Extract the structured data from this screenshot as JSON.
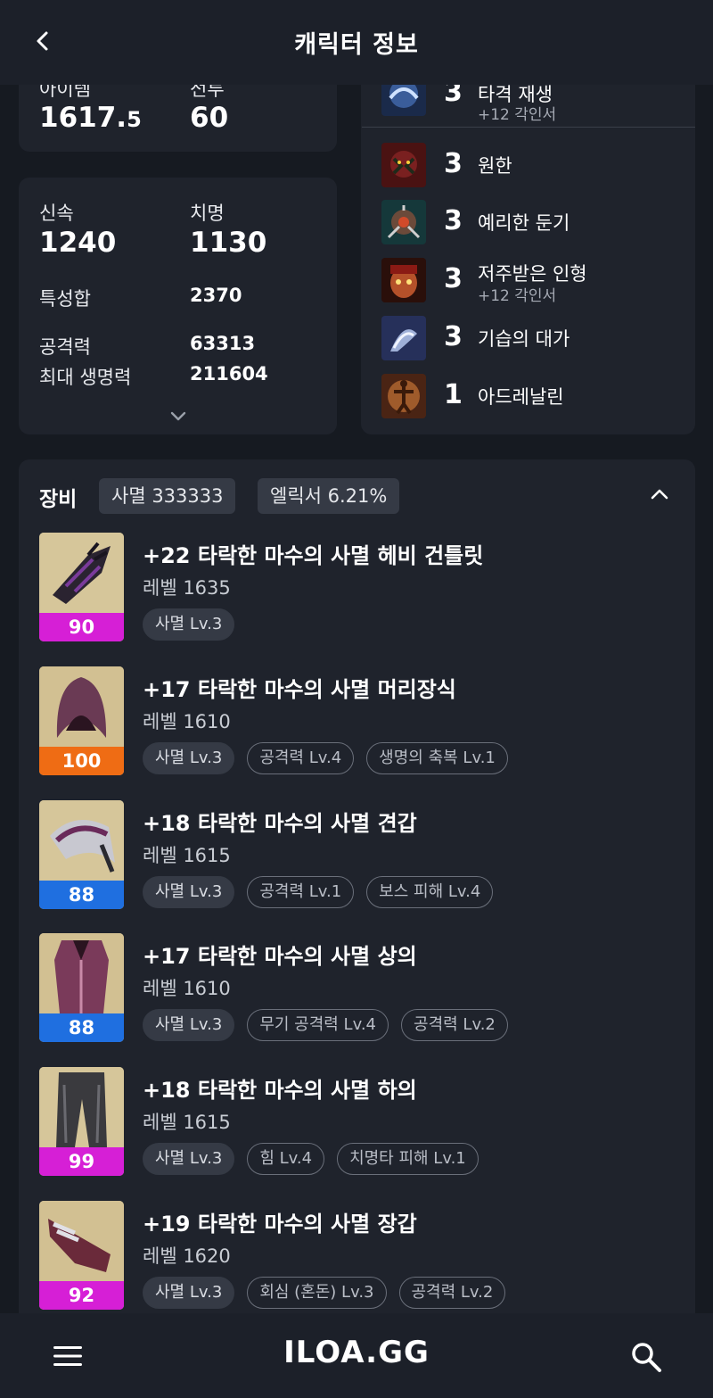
{
  "header": {
    "title": "캐릭터 정보",
    "back_icon": "chevron-left-icon"
  },
  "stats_top": {
    "item_level_label": "아이템",
    "item_level_main": "1617.",
    "item_level_dec": "5",
    "battle_label": "전투",
    "battle_value": "60"
  },
  "stats": {
    "swiftness_label": "신속",
    "swiftness_value": "1240",
    "crit_label": "치명",
    "crit_value": "1130",
    "trait_sum_label": "특성합",
    "trait_sum_value": "2370",
    "attack_label": "공격력",
    "attack_value": "63313",
    "max_hp_label": "최대 생명력",
    "max_hp_value": "211604",
    "expand_icon": "chevron-down-icon"
  },
  "engravings": [
    {
      "level": "3",
      "name": "타격 재생",
      "sub": "+12 각인서"
    },
    {
      "level": "3",
      "name": "원한",
      "sub": ""
    },
    {
      "level": "3",
      "name": "예리한 둔기",
      "sub": ""
    },
    {
      "level": "3",
      "name": "저주받은 인형",
      "sub": "+12 각인서"
    },
    {
      "level": "3",
      "name": "기습의 대가",
      "sub": ""
    },
    {
      "level": "1",
      "name": "아드레날린",
      "sub": ""
    }
  ],
  "equipment": {
    "title": "장비",
    "set_chip": "사멸 333333",
    "elixir_chip": "엘릭서 6.21%",
    "collapse_icon": "chevron-up-icon",
    "items": [
      {
        "name": "+22 타락한 마수의 사멸 헤비 건틀릿",
        "level": "레벨 1635",
        "quality": "90",
        "quality_color": "#d61fd6",
        "tags": [
          "사멸 Lv.3"
        ]
      },
      {
        "name": "+17 타락한 마수의 사멸 머리장식",
        "level": "레벨 1610",
        "quality": "100",
        "quality_color": "#ef6c14",
        "tags": [
          "사멸 Lv.3",
          "공격력 Lv.4",
          "생명의 축복 Lv.1"
        ]
      },
      {
        "name": "+18 타락한 마수의 사멸 견갑",
        "level": "레벨 1615",
        "quality": "88",
        "quality_color": "#1f6fe0",
        "tags": [
          "사멸 Lv.3",
          "공격력 Lv.1",
          "보스 피해 Lv.4"
        ]
      },
      {
        "name": "+17 타락한 마수의 사멸 상의",
        "level": "레벨 1610",
        "quality": "88",
        "quality_color": "#1f6fe0",
        "tags": [
          "사멸 Lv.3",
          "무기 공격력 Lv.4",
          "공격력 Lv.2"
        ]
      },
      {
        "name": "+18 타락한 마수의 사멸 하의",
        "level": "레벨 1615",
        "quality": "99",
        "quality_color": "#d61fd6",
        "tags": [
          "사멸 Lv.3",
          "힘 Lv.4",
          "치명타 피해 Lv.1"
        ]
      },
      {
        "name": "+19 타락한 마수의 사멸 장갑",
        "level": "레벨 1620",
        "quality": "92",
        "quality_color": "#d61fd6",
        "tags": [
          "사멸 Lv.3",
          "회심 (혼돈) Lv.3",
          "공격력 Lv.2"
        ]
      }
    ]
  },
  "bottom": {
    "logo": "ILOA.GG",
    "menu_icon": "hamburger-menu-icon",
    "search_icon": "search-icon"
  }
}
